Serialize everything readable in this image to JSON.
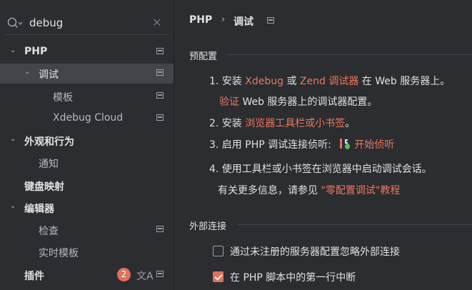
{
  "search": {
    "value": "debug"
  },
  "sidebar": {
    "items": [
      {
        "label": "PHP"
      },
      {
        "label": "调试"
      },
      {
        "label": "模板"
      },
      {
        "label": "Xdebug Cloud"
      },
      {
        "label": "外观和行为"
      },
      {
        "label": "通知"
      },
      {
        "label": "键盘映射"
      },
      {
        "label": "编辑器"
      },
      {
        "label": "检查"
      },
      {
        "label": "实时模板"
      },
      {
        "label": "插件",
        "badge": "2"
      }
    ]
  },
  "breadcrumb": {
    "root": "PHP",
    "separator": "›",
    "current": "调试"
  },
  "preconfig": {
    "title": "预配置",
    "step1": {
      "prefix": "1. 安装 ",
      "link1": "Xdebug",
      "mid": " 或 ",
      "link2": "Zend 调试器",
      "suffix": " 在 Web 服务器上。"
    },
    "step1b": {
      "link": "验证",
      "suffix": " Web 服务器上的调试器配置。"
    },
    "step2": {
      "prefix": "2. 安装 ",
      "link": "浏览器工具栏或小书签",
      "suffix": "。"
    },
    "step3": {
      "prefix": "3. 启用 PHP 调试连接侦听: ",
      "link": "开始侦听"
    },
    "step4": {
      "text": "4. 使用工具栏或小书签在浏览器中启动调试会话。"
    },
    "more": {
      "prefix": "有关更多信息，请参见 ",
      "link": "\"零配置调试\"教程"
    }
  },
  "external": {
    "title": "外部连接",
    "options": [
      {
        "label": "通过未注册的服务器配置忽略外部连接",
        "checked": false
      },
      {
        "label": "在 PHP 脚本中的第一行中断",
        "checked": true
      }
    ]
  },
  "colors": {
    "background": "#2b2d30",
    "selected": "#43454a",
    "link": "#e8795f",
    "accent": "#e0715a"
  }
}
